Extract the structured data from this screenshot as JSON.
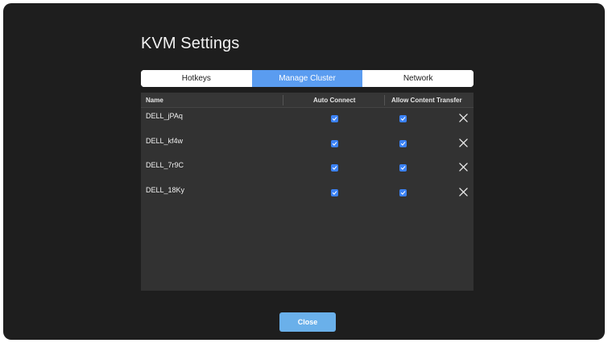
{
  "window": {
    "title": "KVM Settings"
  },
  "tabs": [
    {
      "label": "Hotkeys",
      "active": false
    },
    {
      "label": "Manage Cluster",
      "active": true
    },
    {
      "label": "Network",
      "active": false
    }
  ],
  "table": {
    "columns": [
      "Name",
      "Auto Connect",
      "Allow Content Transfer"
    ],
    "rows": [
      {
        "name": "DELL_jPAq",
        "auto_connect": true,
        "allow_content_transfer": true
      },
      {
        "name": "DELL_kf4w",
        "auto_connect": true,
        "allow_content_transfer": true
      },
      {
        "name": "DELL_7r9C",
        "auto_connect": true,
        "allow_content_transfer": true
      },
      {
        "name": "DELL_18Ky",
        "auto_connect": true,
        "allow_content_transfer": true
      }
    ]
  },
  "footer": {
    "close_label": "Close"
  },
  "colors": {
    "window_bg": "#1e1e1e",
    "panel_bg": "#323232",
    "accent_tab": "#5a9cf0",
    "checkbox": "#3b82f6",
    "close_button": "#6ab0ea"
  },
  "icons": {
    "checkbox": "checkmark-icon",
    "remove": "close-icon"
  }
}
